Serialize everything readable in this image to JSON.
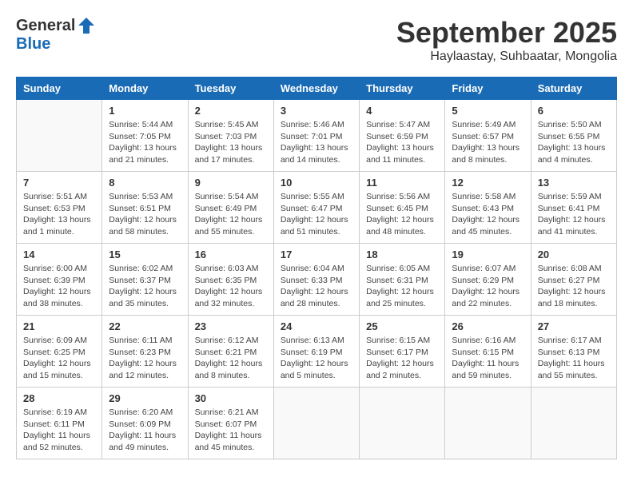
{
  "logo": {
    "general": "General",
    "blue": "Blue"
  },
  "header": {
    "month": "September 2025",
    "location": "Haylaastay, Suhbaatar, Mongolia"
  },
  "weekdays": [
    "Sunday",
    "Monday",
    "Tuesday",
    "Wednesday",
    "Thursday",
    "Friday",
    "Saturday"
  ],
  "weeks": [
    [
      {
        "day": "",
        "info": ""
      },
      {
        "day": "1",
        "info": "Sunrise: 5:44 AM\nSunset: 7:05 PM\nDaylight: 13 hours\nand 21 minutes."
      },
      {
        "day": "2",
        "info": "Sunrise: 5:45 AM\nSunset: 7:03 PM\nDaylight: 13 hours\nand 17 minutes."
      },
      {
        "day": "3",
        "info": "Sunrise: 5:46 AM\nSunset: 7:01 PM\nDaylight: 13 hours\nand 14 minutes."
      },
      {
        "day": "4",
        "info": "Sunrise: 5:47 AM\nSunset: 6:59 PM\nDaylight: 13 hours\nand 11 minutes."
      },
      {
        "day": "5",
        "info": "Sunrise: 5:49 AM\nSunset: 6:57 PM\nDaylight: 13 hours\nand 8 minutes."
      },
      {
        "day": "6",
        "info": "Sunrise: 5:50 AM\nSunset: 6:55 PM\nDaylight: 13 hours\nand 4 minutes."
      }
    ],
    [
      {
        "day": "7",
        "info": "Sunrise: 5:51 AM\nSunset: 6:53 PM\nDaylight: 13 hours\nand 1 minute."
      },
      {
        "day": "8",
        "info": "Sunrise: 5:53 AM\nSunset: 6:51 PM\nDaylight: 12 hours\nand 58 minutes."
      },
      {
        "day": "9",
        "info": "Sunrise: 5:54 AM\nSunset: 6:49 PM\nDaylight: 12 hours\nand 55 minutes."
      },
      {
        "day": "10",
        "info": "Sunrise: 5:55 AM\nSunset: 6:47 PM\nDaylight: 12 hours\nand 51 minutes."
      },
      {
        "day": "11",
        "info": "Sunrise: 5:56 AM\nSunset: 6:45 PM\nDaylight: 12 hours\nand 48 minutes."
      },
      {
        "day": "12",
        "info": "Sunrise: 5:58 AM\nSunset: 6:43 PM\nDaylight: 12 hours\nand 45 minutes."
      },
      {
        "day": "13",
        "info": "Sunrise: 5:59 AM\nSunset: 6:41 PM\nDaylight: 12 hours\nand 41 minutes."
      }
    ],
    [
      {
        "day": "14",
        "info": "Sunrise: 6:00 AM\nSunset: 6:39 PM\nDaylight: 12 hours\nand 38 minutes."
      },
      {
        "day": "15",
        "info": "Sunrise: 6:02 AM\nSunset: 6:37 PM\nDaylight: 12 hours\nand 35 minutes."
      },
      {
        "day": "16",
        "info": "Sunrise: 6:03 AM\nSunset: 6:35 PM\nDaylight: 12 hours\nand 32 minutes."
      },
      {
        "day": "17",
        "info": "Sunrise: 6:04 AM\nSunset: 6:33 PM\nDaylight: 12 hours\nand 28 minutes."
      },
      {
        "day": "18",
        "info": "Sunrise: 6:05 AM\nSunset: 6:31 PM\nDaylight: 12 hours\nand 25 minutes."
      },
      {
        "day": "19",
        "info": "Sunrise: 6:07 AM\nSunset: 6:29 PM\nDaylight: 12 hours\nand 22 minutes."
      },
      {
        "day": "20",
        "info": "Sunrise: 6:08 AM\nSunset: 6:27 PM\nDaylight: 12 hours\nand 18 minutes."
      }
    ],
    [
      {
        "day": "21",
        "info": "Sunrise: 6:09 AM\nSunset: 6:25 PM\nDaylight: 12 hours\nand 15 minutes."
      },
      {
        "day": "22",
        "info": "Sunrise: 6:11 AM\nSunset: 6:23 PM\nDaylight: 12 hours\nand 12 minutes."
      },
      {
        "day": "23",
        "info": "Sunrise: 6:12 AM\nSunset: 6:21 PM\nDaylight: 12 hours\nand 8 minutes."
      },
      {
        "day": "24",
        "info": "Sunrise: 6:13 AM\nSunset: 6:19 PM\nDaylight: 12 hours\nand 5 minutes."
      },
      {
        "day": "25",
        "info": "Sunrise: 6:15 AM\nSunset: 6:17 PM\nDaylight: 12 hours\nand 2 minutes."
      },
      {
        "day": "26",
        "info": "Sunrise: 6:16 AM\nSunset: 6:15 PM\nDaylight: 11 hours\nand 59 minutes."
      },
      {
        "day": "27",
        "info": "Sunrise: 6:17 AM\nSunset: 6:13 PM\nDaylight: 11 hours\nand 55 minutes."
      }
    ],
    [
      {
        "day": "28",
        "info": "Sunrise: 6:19 AM\nSunset: 6:11 PM\nDaylight: 11 hours\nand 52 minutes."
      },
      {
        "day": "29",
        "info": "Sunrise: 6:20 AM\nSunset: 6:09 PM\nDaylight: 11 hours\nand 49 minutes."
      },
      {
        "day": "30",
        "info": "Sunrise: 6:21 AM\nSunset: 6:07 PM\nDaylight: 11 hours\nand 45 minutes."
      },
      {
        "day": "",
        "info": ""
      },
      {
        "day": "",
        "info": ""
      },
      {
        "day": "",
        "info": ""
      },
      {
        "day": "",
        "info": ""
      }
    ]
  ]
}
